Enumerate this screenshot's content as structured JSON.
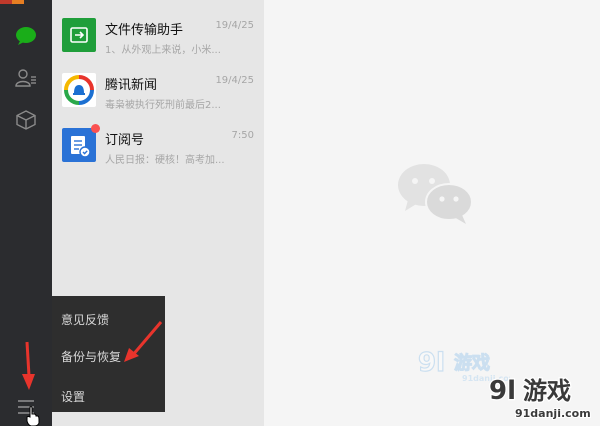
{
  "chats": [
    {
      "name": "文件传输助手",
      "time": "19/4/25",
      "preview": "1、从外观上来说，小米...",
      "avatar": "file-transfer-icon",
      "color": "#1f9e3a"
    },
    {
      "name": "腾讯新闻",
      "time": "19/4/25",
      "preview": "毒枭被执行死刑前最后2...",
      "avatar": "tencent-news-icon",
      "color": "#ffffff"
    },
    {
      "name": "订阅号",
      "time": "7:50",
      "preview": "人民日报：硬核！高考加...",
      "avatar": "subscription-icon",
      "color": "#2a72d6",
      "unread": true
    }
  ],
  "menu": {
    "items": [
      {
        "label": "意见反馈"
      },
      {
        "label": "备份与恢复"
      },
      {
        "label": "设置"
      }
    ]
  },
  "watermark": {
    "brand_digits": "9l",
    "brand_text": "游戏",
    "domain": "91danji.com"
  },
  "colors": {
    "sidebar": "#2b2c2f",
    "chatlist": "#e6e6e6",
    "content": "#f5f5f5",
    "accent_green": "#1aad19",
    "annotation_red": "#e8342c"
  }
}
